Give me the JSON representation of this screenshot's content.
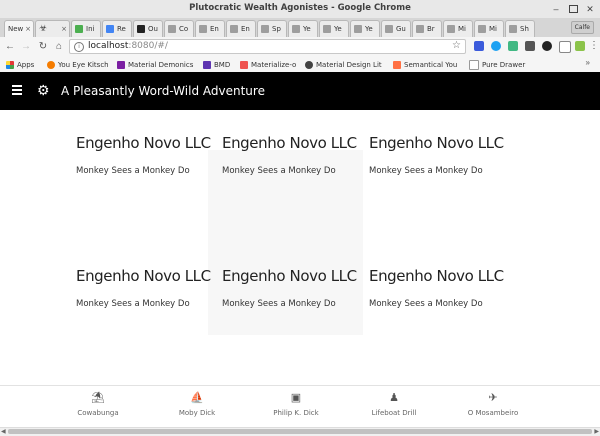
{
  "window": {
    "title": "Plutocratic Wealth Agonistes - Google Chrome"
  },
  "tabs": [
    {
      "label": "New",
      "color": "#c8c8c8"
    },
    {
      "label": "",
      "color": "#444444"
    },
    {
      "label": "Ini",
      "color": "#4caf50"
    },
    {
      "label": "Re",
      "color": "#4285f4"
    },
    {
      "label": "Ou",
      "color": "#222222"
    },
    {
      "label": "Co",
      "color": "#9e9e9e"
    },
    {
      "label": "En",
      "color": "#9e9e9e"
    },
    {
      "label": "En",
      "color": "#9e9e9e"
    },
    {
      "label": "Sp",
      "color": "#9e9e9e"
    },
    {
      "label": "Ye",
      "color": "#9e9e9e"
    },
    {
      "label": "Ye",
      "color": "#9e9e9e"
    },
    {
      "label": "Ye",
      "color": "#9e9e9e"
    },
    {
      "label": "Gu",
      "color": "#9e9e9e"
    },
    {
      "label": "Br",
      "color": "#9e9e9e"
    },
    {
      "label": "Mi",
      "color": "#9e9e9e"
    },
    {
      "label": "Mi",
      "color": "#9e9e9e"
    },
    {
      "label": "Sh",
      "color": "#9e9e9e"
    }
  ],
  "profile_label": "Calfe",
  "address": {
    "host": "localhost",
    "path": ":8080/#/"
  },
  "bookmarks": [
    {
      "label": "Apps",
      "color": "#e53935"
    },
    {
      "label": "You Eye Kitsch",
      "color": "#f57c00"
    },
    {
      "label": "Material Demonics",
      "color": "#7b1fa2"
    },
    {
      "label": "BMD",
      "color": "#5e35b1"
    },
    {
      "label": "Materialize-o",
      "color": "#ef5350"
    },
    {
      "label": "Material Design Lit",
      "color": "#424242"
    },
    {
      "label": "Semantical You",
      "color": "#ff7043"
    },
    {
      "label": "Pure Drawer",
      "color": "#9e9e9e"
    }
  ],
  "appbar": {
    "title": "A Pleasantly Word-Wild Adventure",
    "logo_icon": "gears-icon",
    "menu_icon": "hamburger-icon"
  },
  "cards": [
    {
      "title": "Engenho Novo LLC",
      "subtitle": "Monkey Sees a Monkey Do"
    },
    {
      "title": "Engenho Novo LLC",
      "subtitle": "Monkey Sees a Monkey Do"
    },
    {
      "title": "Engenho Novo LLC",
      "subtitle": "Monkey Sees a Monkey Do"
    },
    {
      "title": "Engenho Novo LLC",
      "subtitle": "Monkey Sees a Monkey Do"
    },
    {
      "title": "Engenho Novo LLC",
      "subtitle": "Monkey Sees a Monkey Do"
    },
    {
      "title": "Engenho Novo LLC",
      "subtitle": "Monkey Sees a Monkey Do"
    }
  ],
  "bottom_nav": [
    {
      "label": "Cowabunga",
      "icon": "beach-umbrella-icon"
    },
    {
      "label": "Moby Dick",
      "icon": "ship-icon"
    },
    {
      "label": "Philip K. Dick",
      "icon": "box-icon"
    },
    {
      "label": "Lifeboat Drill",
      "icon": "person-walking-icon"
    },
    {
      "label": "O Mosambeiro",
      "icon": "airplane-icon"
    }
  ]
}
